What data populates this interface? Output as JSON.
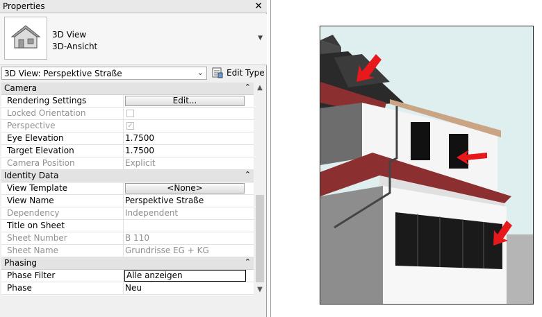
{
  "panel": {
    "title": "Properties",
    "close_glyph": "✕"
  },
  "type_selector": {
    "icon": "house-icon",
    "line1": "3D View",
    "line2": "3D-Ansicht"
  },
  "instance": {
    "selected": "3D View: Perspektive Straße",
    "edit_type_label": "Edit Type"
  },
  "groups": {
    "camera": "Camera",
    "identity": "Identity Data",
    "phasing": "Phasing"
  },
  "props": {
    "rendering_settings": {
      "name": "Rendering Settings",
      "value": "Edit..."
    },
    "locked_orientation": {
      "name": "Locked Orientation",
      "checked": false
    },
    "perspective": {
      "name": "Perspective",
      "checked": true
    },
    "eye_elevation": {
      "name": "Eye Elevation",
      "value": "1.7500"
    },
    "target_elevation": {
      "name": "Target Elevation",
      "value": "1.7500"
    },
    "camera_position": {
      "name": "Camera Position",
      "value": "Explicit"
    },
    "view_template": {
      "name": "View Template",
      "value": "<None>"
    },
    "view_name": {
      "name": "View Name",
      "value": "Perspektive Straße"
    },
    "dependency": {
      "name": "Dependency",
      "value": "Independent"
    },
    "title_on_sheet": {
      "name": "Title on Sheet",
      "value": ""
    },
    "sheet_number": {
      "name": "Sheet Number",
      "value": "B 110"
    },
    "sheet_name": {
      "name": "Sheet Name",
      "value": "Grundrisse  EG + KG"
    },
    "phase_filter": {
      "name": "Phase Filter",
      "value": "Alle anzeigen"
    },
    "phase": {
      "name": "Phase",
      "value": "Neu"
    }
  },
  "colors": {
    "roof": "#8c2f30",
    "arrow": "#e8191b",
    "sky": "#dfeeee"
  }
}
